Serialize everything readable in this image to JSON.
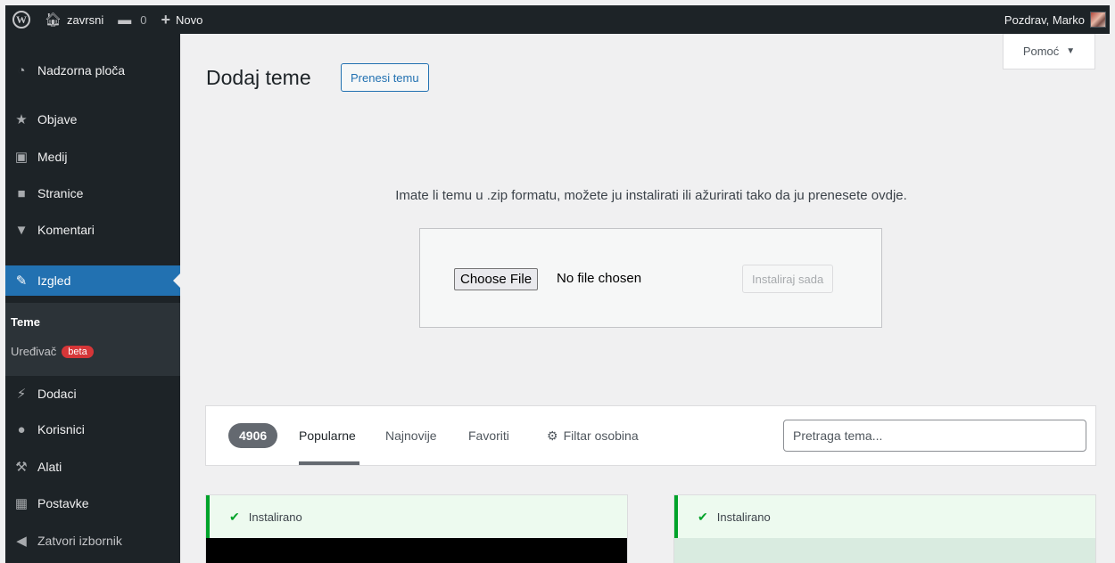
{
  "adminbar": {
    "site_name": "zavrsni",
    "comments_count": "0",
    "new_label": "Novo",
    "greeting": "Pozdrav, Marko"
  },
  "sidebar": {
    "items": [
      {
        "label": "Nadzorna ploča",
        "icon": "dashboard-icon"
      },
      {
        "label": "Objave",
        "icon": "pin-icon"
      },
      {
        "label": "Medij",
        "icon": "media-icon"
      },
      {
        "label": "Stranice",
        "icon": "page-icon"
      },
      {
        "label": "Komentari",
        "icon": "comment-icon"
      },
      {
        "label": "Izgled",
        "icon": "appearance-icon"
      },
      {
        "label": "Dodaci",
        "icon": "plugin-icon"
      },
      {
        "label": "Korisnici",
        "icon": "users-icon"
      },
      {
        "label": "Alati",
        "icon": "tools-icon"
      },
      {
        "label": "Postavke",
        "icon": "settings-icon"
      },
      {
        "label": "Zatvori izbornik",
        "icon": "collapse-icon"
      }
    ],
    "submenu": {
      "themes": "Teme",
      "editor": "Uređivač",
      "editor_badge": "beta"
    }
  },
  "help": {
    "label": "Pomoć"
  },
  "page": {
    "title": "Dodaj teme",
    "upload_button": "Prenesi temu",
    "upload_help": "Imate li temu u .zip formatu, možete ju instalirati ili ažurirati tako da ju prenesete ovdje.",
    "choose_file": "Choose File",
    "no_file": "No file chosen",
    "install_button": "Instaliraj sada"
  },
  "filter": {
    "count": "4906",
    "tabs": [
      "Popularne",
      "Najnovije",
      "Favoriti"
    ],
    "feature_filter": "Filtar osobina",
    "search_placeholder": "Pretraga tema..."
  },
  "themes": [
    {
      "notice": "Instalirano"
    },
    {
      "notice": "Instalirano"
    }
  ],
  "colors": {
    "accent": "#2271b1",
    "admin_bar": "#1d2327",
    "installed": "#00a32a",
    "badge": "#d63638"
  }
}
